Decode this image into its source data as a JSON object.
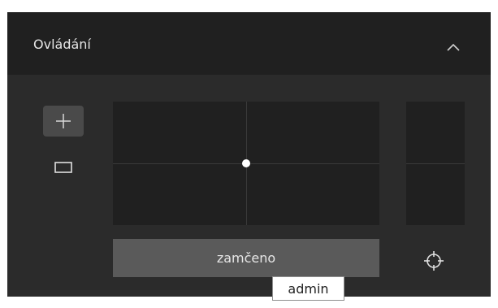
{
  "panel": {
    "title": "Ovládání",
    "collapse_icon": "chevron-up-icon"
  },
  "tools": [
    {
      "icon": "plus-icon",
      "active": true
    },
    {
      "icon": "rectangle-icon",
      "active": false
    }
  ],
  "controls": {
    "lock_label": "zamčeno",
    "target_icon": "crosshair-icon"
  },
  "tooltip": {
    "text": "admin"
  }
}
